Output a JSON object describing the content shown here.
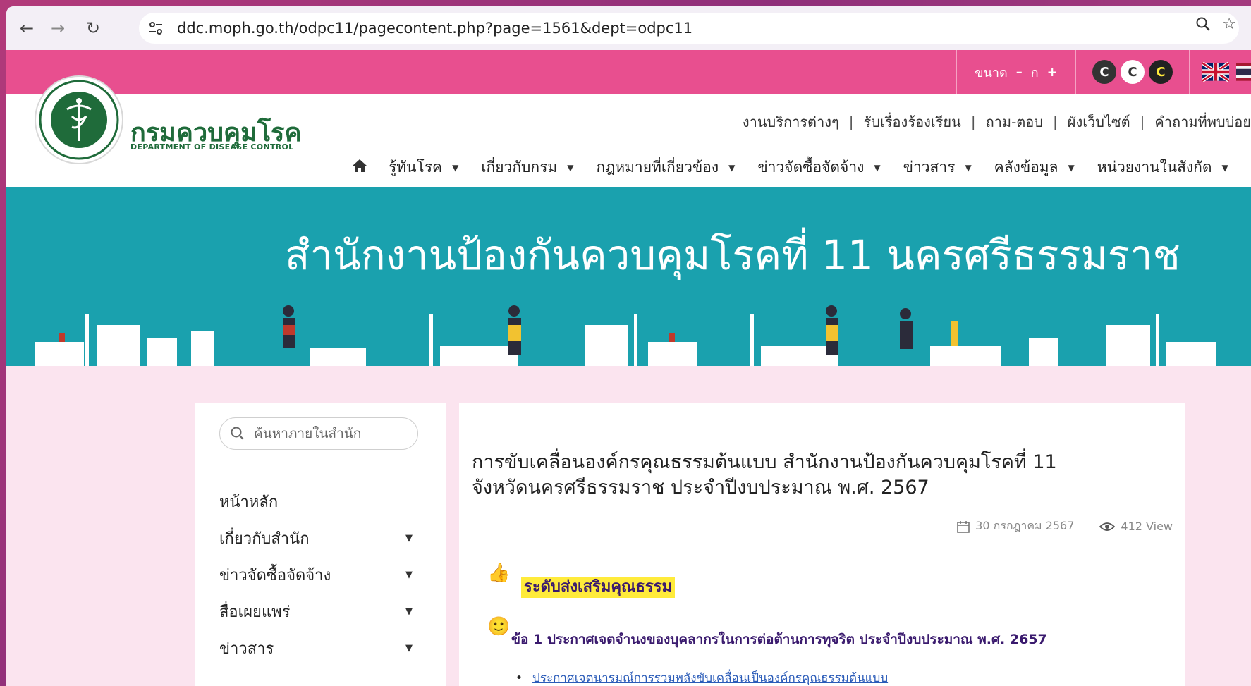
{
  "browser": {
    "url": "ddc.moph.go.th/odpc11/pagecontent.php?page=1561&dept=odpc11"
  },
  "accessibility": {
    "font_size_label": "ขนาด",
    "font_minus": "–",
    "font_normal": "ก",
    "font_plus": "+",
    "contrast_buttons": [
      "C",
      "C",
      "C"
    ]
  },
  "header": {
    "logo_text_th": "กรมควบคุมโรค",
    "logo_text_en": "DEPARTMENT OF DISEASE CONTROL",
    "utility_links": [
      "งานบริการต่างๆ",
      "รับเรื่องร้องเรียน",
      "ถาม-ตอบ",
      "ผังเว็บไซต์",
      "คำถามที่พบบ่อย"
    ],
    "nav_items": [
      "รู้ทันโรค",
      "เกี่ยวกับกรม",
      "กฎหมายที่เกี่ยวข้อง",
      "ข่าวจัดซื้อจัดจ้าง",
      "ข่าวสาร",
      "คลังข้อมูล",
      "หน่วยงานในสังกัด"
    ]
  },
  "banner": {
    "title": "สำนักงานป้องกันควบคุมโรคที่ 11 นครศรีธรรมราช"
  },
  "sidebar": {
    "search_placeholder": "ค้นหาภายในสำนัก",
    "items": [
      {
        "label": "หน้าหลัก"
      },
      {
        "label": "เกี่ยวกับสำนัก"
      },
      {
        "label": "ข่าวจัดซื้อจัดจ้าง"
      },
      {
        "label": "สื่อเผยแพร่"
      },
      {
        "label": "ข่าวสาร"
      }
    ]
  },
  "article": {
    "title_line1": "การขับเคลื่อนองค์กรคุณธรรมต้นแบบ สำนักงานป้องกันควบคุมโรคที่ 11",
    "title_line2": "จังหวัดนครศรีธรรมราช ประจำปีงบประมาณ พ.ศ. 2567",
    "date": "30 กรกฎาคม 2567",
    "views": "412 View",
    "section_heading": "ระดับส่งเสริมคุณธรรม",
    "item_1": "ข้อ 1 ประกาศเจตจำนงของบุคลากรในการต่อต้านการทุจริต  ประจำปีงบประมาณ พ.ศ. 2657",
    "sub_link": "ประกาศเจตนารมณ์การรวมพลังขับเคลื่อนเป็นองค์กรคุณธรรมต้นแบบ"
  },
  "colors": {
    "top_strip": "#e84f8f",
    "banner": "#1aa1ae",
    "page_bg": "#fbe4ef",
    "heading_highlight": "#ffeb3b"
  }
}
